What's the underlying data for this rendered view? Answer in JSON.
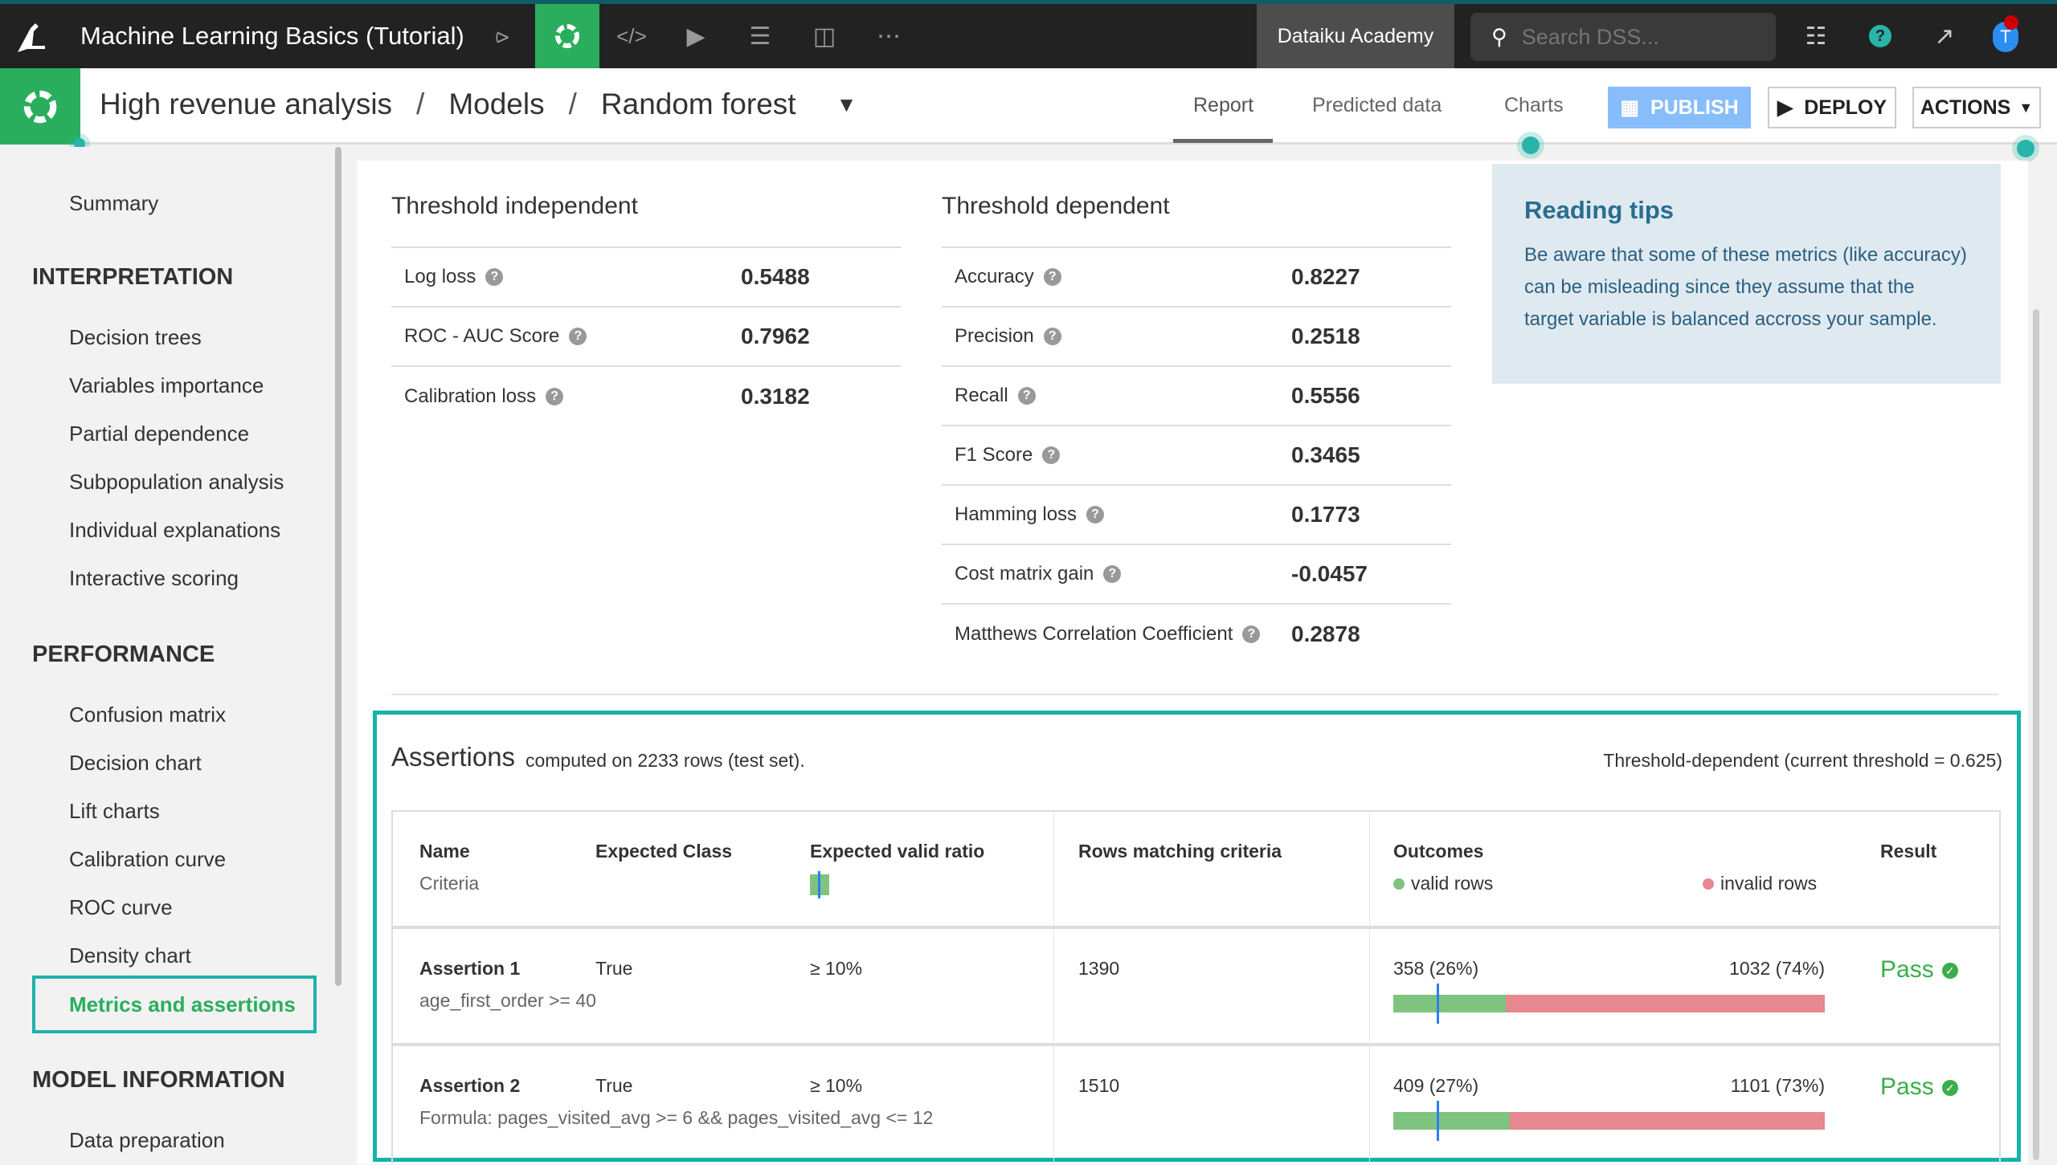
{
  "app": {
    "project_title": "Machine Learning Basics (Tutorial)",
    "instance": "Dataiku Academy",
    "search_placeholder": "Search DSS...",
    "avatar_letter": "T"
  },
  "topbar_icons": [
    "flow-icon",
    "ml-icon",
    "code-icon",
    "run-icon",
    "datasets-stack-icon",
    "dashboard-icon",
    "more-icon"
  ],
  "breadcrumb": [
    "High revenue analysis",
    "Models",
    "Random forest"
  ],
  "breadcrumb_sep": "/",
  "tabs": [
    {
      "label": "Report",
      "active": true
    },
    {
      "label": "Predicted data"
    },
    {
      "label": "Charts"
    }
  ],
  "buttons": {
    "publish": "PUBLISH",
    "deploy": "DEPLOY",
    "actions": "ACTIONS"
  },
  "sidebar": {
    "summary": "Summary",
    "sections": [
      {
        "title": "INTERPRETATION",
        "items": [
          "Decision trees",
          "Variables importance",
          "Partial dependence",
          "Subpopulation analysis",
          "Individual explanations",
          "Interactive scoring"
        ]
      },
      {
        "title": "PERFORMANCE",
        "items": [
          "Confusion matrix",
          "Decision chart",
          "Lift charts",
          "Calibration curve",
          "ROC curve",
          "Density chart",
          "Metrics and assertions"
        ]
      },
      {
        "title": "MODEL INFORMATION",
        "items": [
          "Data preparation"
        ]
      }
    ],
    "active": "Metrics and assertions"
  },
  "threshold_independent": {
    "title": "Threshold independent",
    "metrics": [
      {
        "label": "Log loss",
        "value": "0.5488"
      },
      {
        "label": "ROC - AUC Score",
        "value": "0.7962"
      },
      {
        "label": "Calibration loss",
        "value": "0.3182"
      }
    ]
  },
  "threshold_dependent": {
    "title": "Threshold dependent",
    "metrics": [
      {
        "label": "Accuracy",
        "value": "0.8227"
      },
      {
        "label": "Precision",
        "value": "0.2518"
      },
      {
        "label": "Recall",
        "value": "0.5556"
      },
      {
        "label": "F1 Score",
        "value": "0.3465"
      },
      {
        "label": "Hamming loss",
        "value": "0.1773"
      },
      {
        "label": "Cost matrix gain",
        "value": "-0.0457"
      },
      {
        "label": "Matthews Correlation Coefficient",
        "value": "0.2878"
      }
    ]
  },
  "reading_tips": {
    "title": "Reading tips",
    "text": "Be aware that some of these metrics (like accuracy) can be misleading since they assume that the target variable is balanced accross your sample."
  },
  "assertions": {
    "title": "Assertions",
    "subtitle": "computed on 2233 rows (test set).",
    "threshold_note": "Threshold-dependent (current threshold = 0.625)",
    "headers": {
      "name": "Name",
      "criteria": "Criteria",
      "expected_class": "Expected Class",
      "expected_ratio": "Expected valid ratio",
      "rows_matching": "Rows matching criteria",
      "outcomes": "Outcomes",
      "valid_rows": "valid rows",
      "invalid_rows": "invalid rows",
      "result": "Result"
    },
    "colors": {
      "valid": "#7ec47f",
      "invalid": "#e7878f",
      "threshold_marker": "#2b7ff0",
      "pass": "#3aae4a"
    },
    "rows": [
      {
        "name": "Assertion 1",
        "criteria": "age_first_order >= 40",
        "expected_class": "True",
        "expected_ratio": "≥ 10%",
        "expected_ratio_value": 0.1,
        "rows_matching": "1390",
        "valid": "358 (26%)",
        "invalid": "1032 (74%)",
        "valid_fraction": 0.26,
        "result": "Pass"
      },
      {
        "name": "Assertion 2",
        "criteria": "Formula: pages_visited_avg >= 6 && pages_visited_avg <= 12",
        "expected_class": "True",
        "expected_ratio": "≥ 10%",
        "expected_ratio_value": 0.1,
        "rows_matching": "1510",
        "valid": "409 (27%)",
        "invalid": "1101 (73%)",
        "valid_fraction": 0.27,
        "result": "Pass"
      }
    ]
  }
}
